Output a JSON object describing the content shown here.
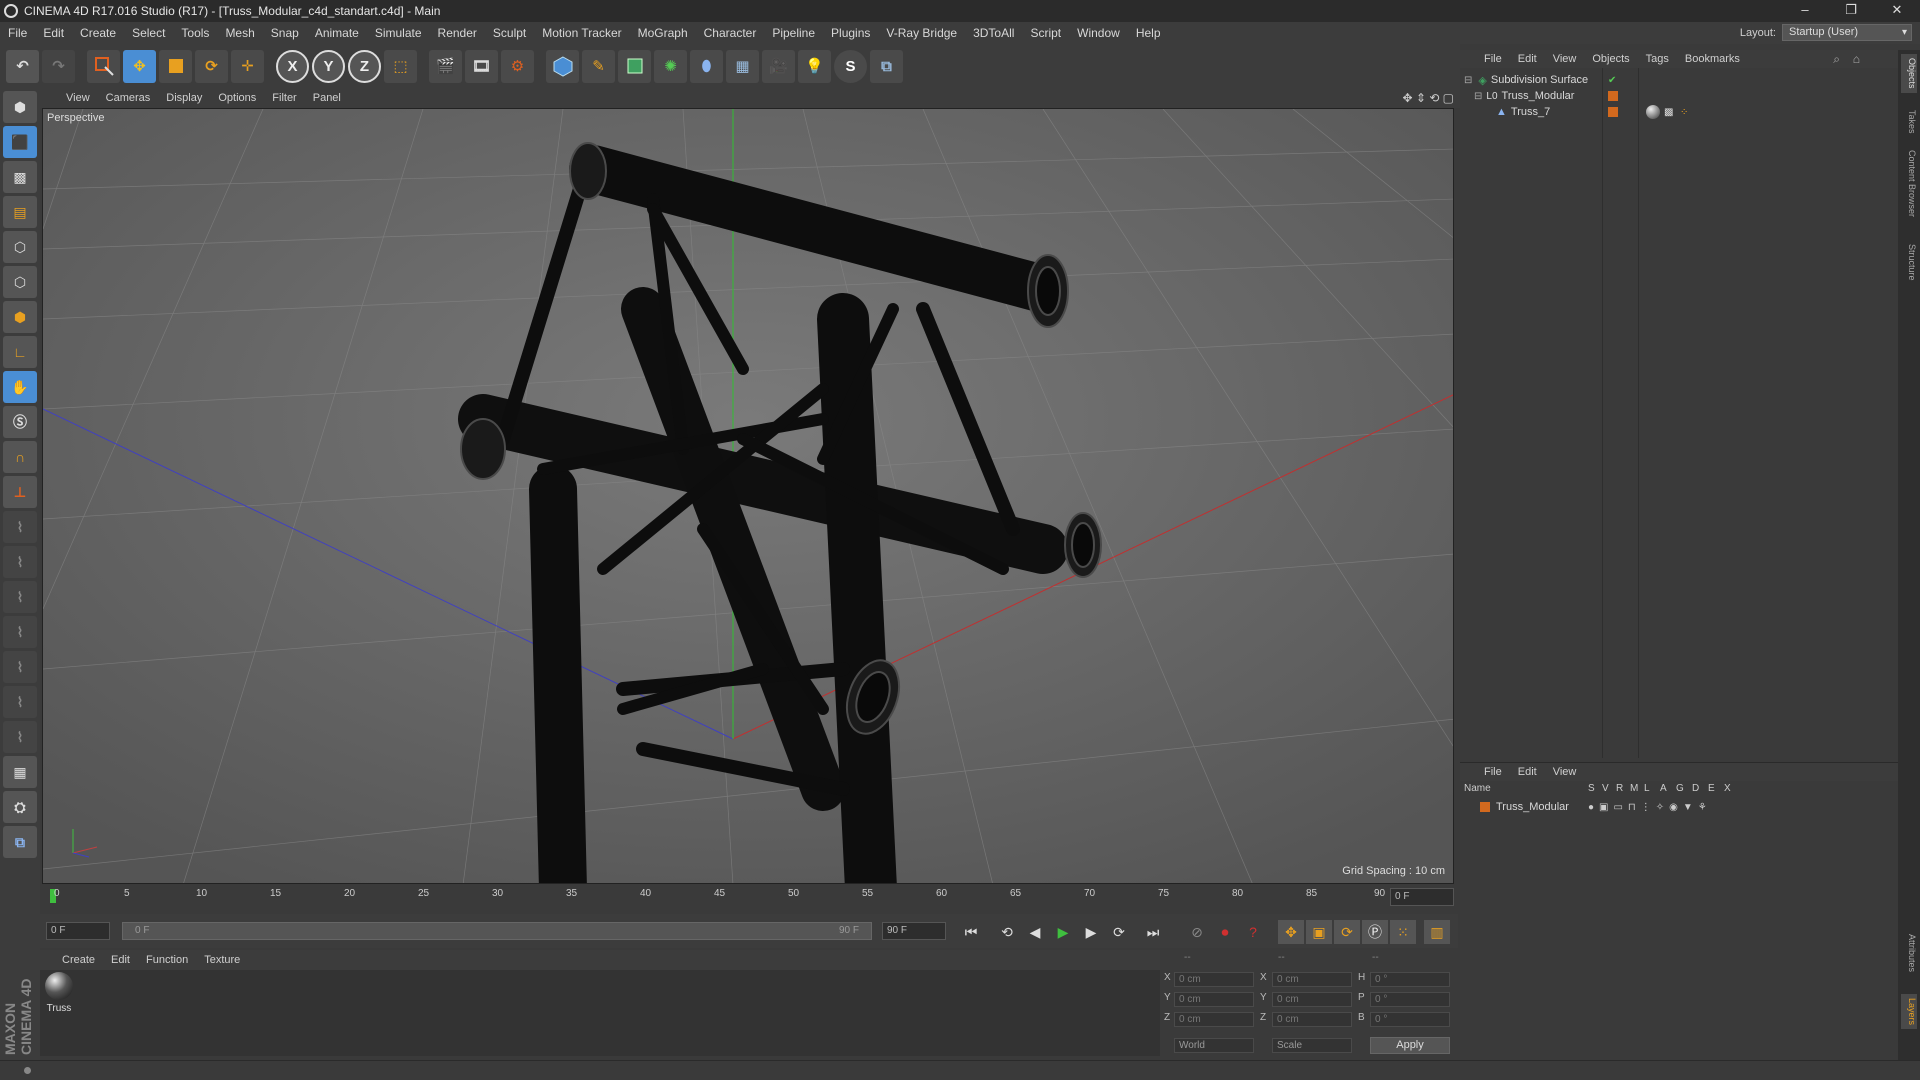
{
  "window": {
    "title": "CINEMA 4D R17.016 Studio (R17) - [Truss_Modular_c4d_standart.c4d] - Main",
    "controls": [
      "–",
      "❐",
      "✕"
    ]
  },
  "menubar": {
    "items": [
      "File",
      "Edit",
      "Create",
      "Select",
      "Tools",
      "Mesh",
      "Snap",
      "Animate",
      "Simulate",
      "Render",
      "Sculpt",
      "Motion Tracker",
      "MoGraph",
      "Character",
      "Pipeline",
      "Plugins",
      "V-Ray Bridge",
      "3DToAll",
      "Script",
      "Window",
      "Help"
    ],
    "layout_label": "Layout:",
    "layout_value": "Startup (User)"
  },
  "toolbar": {
    "axis_x": "X",
    "axis_y": "Y",
    "axis_z": "Z"
  },
  "viewport": {
    "menu": [
      "View",
      "Cameras",
      "Display",
      "Options",
      "Filter",
      "Panel"
    ],
    "label": "Perspective",
    "grid_spacing": "Grid Spacing : 10 cm"
  },
  "timeline": {
    "ticks": [
      "0",
      "5",
      "10",
      "15",
      "20",
      "25",
      "30",
      "35",
      "40",
      "45",
      "50",
      "55",
      "60",
      "65",
      "70",
      "75",
      "80",
      "85",
      "90"
    ],
    "current_frame": "0 F",
    "start_field": "0 F",
    "range_start": "0 F",
    "range_end": "90 F",
    "end_field": "90 F"
  },
  "material_manager": {
    "menu": [
      "Create",
      "Edit",
      "Function",
      "Texture"
    ],
    "materials": [
      {
        "name": "Truss"
      }
    ]
  },
  "coordinates": {
    "header": [
      "--",
      "--",
      "--"
    ],
    "rows": [
      {
        "axis": "X",
        "pos": "0 cm",
        "size_axis": "X",
        "size": "0 cm",
        "rot_axis": "H",
        "rot": "0 °"
      },
      {
        "axis": "Y",
        "pos": "0 cm",
        "size_axis": "Y",
        "size": "0 cm",
        "rot_axis": "P",
        "rot": "0 °"
      },
      {
        "axis": "Z",
        "pos": "0 cm",
        "size_axis": "Z",
        "size": "0 cm",
        "rot_axis": "B",
        "rot": "0 °"
      }
    ],
    "space_select": "World",
    "mode_select": "Scale",
    "apply_label": "Apply"
  },
  "object_manager": {
    "menu": [
      "File",
      "Edit",
      "View",
      "Objects",
      "Tags",
      "Bookmarks"
    ],
    "objects": [
      {
        "name": "Subdivision Surface"
      },
      {
        "name": "Truss_Modular"
      },
      {
        "name": "Truss_7"
      }
    ]
  },
  "layer_manager": {
    "menu": [
      "File",
      "Edit",
      "View"
    ],
    "columns": [
      "Name",
      "S",
      "V",
      "R",
      "M",
      "L",
      "A",
      "G",
      "D",
      "E",
      "X"
    ],
    "rows": [
      {
        "name": "Truss_Modular"
      }
    ]
  },
  "side_tabs": {
    "top": [
      "Objects",
      "Takes",
      "Content Browser",
      "Structure"
    ],
    "bottom": [
      "Attributes",
      "Layers"
    ]
  },
  "branding": "MAXON CINEMA 4D",
  "colors": {
    "accent_blue": "#4a8ed4",
    "layer_orange": "#d2691e",
    "play_green": "#3fbf3f",
    "record_red": "#d03030"
  }
}
